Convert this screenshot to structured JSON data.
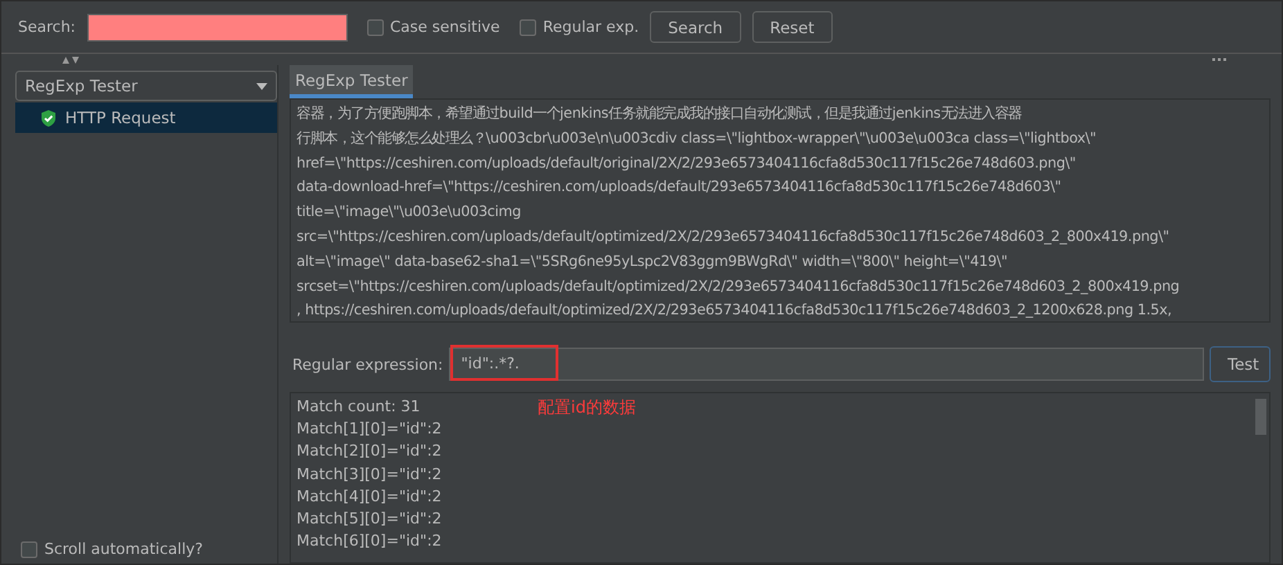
{
  "search_bar": {
    "label": "Search:",
    "invalid": true,
    "case_sensitive": {
      "label": "Case sensitive",
      "checked": false
    },
    "regular_exp": {
      "label": "Regular exp.",
      "checked": false
    },
    "buttons": [
      "Search",
      "Reset"
    ]
  },
  "sidebar": {
    "dropdown": {
      "value": "RegExp Tester"
    },
    "tree": [
      {
        "label": "HTTP Request",
        "passed": true,
        "selected": true
      }
    ],
    "scroll_automatically": {
      "label": "Scroll automatically?",
      "checked": false
    }
  },
  "tabs": [
    {
      "label": "RegExp Tester",
      "selected": true
    }
  ],
  "response_lines": [
    "容器，为了方便跑脚本，希望通过build一个jenkins任务就能完成我的接口自动化测试，但是我通过jenkins无法进入容器",
    "行脚本，这个能够怎么处理么？\\u003cbr\\u003e\\n\\u003cdiv class=\\\"lightbox-wrapper\\\"\\u003e\\u003ca class=\\\"lightbox\\\"",
    "href=\\\"https://ceshiren.com/uploads/default/original/2X/2/293e6573404116cfa8d530c117f15c26e748d603.png\\\"",
    "data-download-href=\\\"https://ceshiren.com/uploads/default/293e6573404116cfa8d530c117f15c26e748d603\\\"",
    "title=\\\"image\\\"\\u003e\\u003cimg",
    "src=\\\"https://ceshiren.com/uploads/default/optimized/2X/2/293e6573404116cfa8d530c117f15c26e748d603_2_800x419.png\\\"",
    "alt=\\\"image\\\" data-base62-sha1=\\\"5SRg6ne95yLspc2V83ggm9BWgRd\\\" width=\\\"800\\\" height=\\\"419\\\"",
    "srcset=\\\"https://ceshiren.com/uploads/default/optimized/2X/2/293e6573404116cfa8d530c117f15c26e748d603_2_800x419.png",
    ", https://ceshiren.com/uploads/default/optimized/2X/2/293e6573404116cfa8d530c117f15c26e748d603_2_1200x628.png 1.5x,"
  ],
  "regex": {
    "label": "Regular expression:",
    "value": "\"id\":.*?.",
    "highlighted": true,
    "annotation": "配置id的数据",
    "button": "Test"
  },
  "results": [
    "Match count: 31",
    "Match[1][0]=\"id\":2",
    "Match[2][0]=\"id\":2",
    "Match[3][0]=\"id\":2",
    "Match[4][0]=\"id\":2",
    "Match[5][0]=\"id\":2",
    "Match[6][0]=\"id\":2"
  ]
}
